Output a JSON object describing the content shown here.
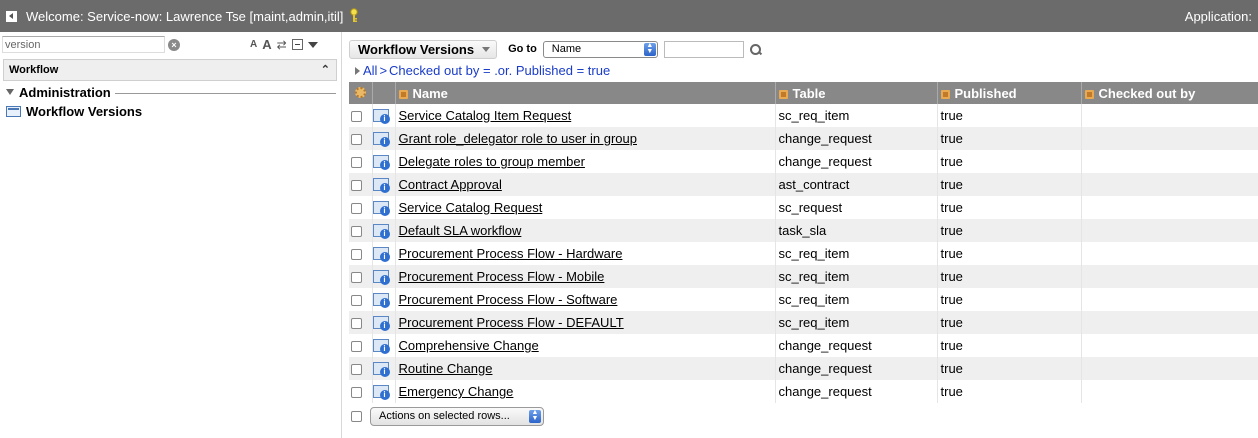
{
  "banner": {
    "welcome": "Welcome: Service-now: Lawrence Tse [maint,admin,itil]",
    "application": "Application:"
  },
  "leftnav": {
    "filter_value": "version",
    "app_header": "Workflow",
    "group_label": "Administration",
    "module_label": "Workflow Versions"
  },
  "list": {
    "title": "Workflow Versions",
    "goto_label": "Go to",
    "goto_selected": "Name",
    "goto_value": "",
    "breadcrumb_all": "All",
    "breadcrumb_sep": ">",
    "breadcrumb_filter": "Checked out by = .or. Published = true",
    "columns": [
      "Name",
      "Table",
      "Published",
      "Checked out by"
    ],
    "rows": [
      {
        "name": "Service Catalog Item Request",
        "table": "sc_req_item",
        "published": "true",
        "checked_out_by": ""
      },
      {
        "name": "Grant role_delegator role to user in group",
        "table": "change_request",
        "published": "true",
        "checked_out_by": ""
      },
      {
        "name": "Delegate roles to group member",
        "table": "change_request",
        "published": "true",
        "checked_out_by": ""
      },
      {
        "name": "Contract Approval",
        "table": "ast_contract",
        "published": "true",
        "checked_out_by": ""
      },
      {
        "name": "Service Catalog Request",
        "table": "sc_request",
        "published": "true",
        "checked_out_by": ""
      },
      {
        "name": "Default SLA workflow",
        "table": "task_sla",
        "published": "true",
        "checked_out_by": ""
      },
      {
        "name": "Procurement Process Flow - Hardware",
        "table": "sc_req_item",
        "published": "true",
        "checked_out_by": ""
      },
      {
        "name": "Procurement Process Flow - Mobile",
        "table": "sc_req_item",
        "published": "true",
        "checked_out_by": ""
      },
      {
        "name": "Procurement Process Flow - Software",
        "table": "sc_req_item",
        "published": "true",
        "checked_out_by": ""
      },
      {
        "name": "Procurement Process Flow - DEFAULT",
        "table": "sc_req_item",
        "published": "true",
        "checked_out_by": ""
      },
      {
        "name": "Comprehensive Change",
        "table": "change_request",
        "published": "true",
        "checked_out_by": ""
      },
      {
        "name": "Routine Change",
        "table": "change_request",
        "published": "true",
        "checked_out_by": ""
      },
      {
        "name": "Emergency Change",
        "table": "change_request",
        "published": "true",
        "checked_out_by": ""
      }
    ],
    "actions_label": "Actions on selected rows..."
  },
  "icons": {
    "banner": [
      "collapse-icon",
      "key-icon"
    ],
    "nav": [
      "clear-icon",
      "font-smaller-icon",
      "font-larger-icon",
      "refresh-icon",
      "collapse-all-icon",
      "menu-icon",
      "collapse-up-icon",
      "workflow-module-icon"
    ],
    "list": [
      "dropdown-icon",
      "search-icon",
      "gear-icon",
      "record-info-icon",
      "sort-column-icon"
    ]
  },
  "colors": {
    "banner_bg": "#6b6b6b",
    "header_bg": "#888888",
    "link_blue": "#1a3cc7",
    "row_alt_bg": "#efefef"
  }
}
